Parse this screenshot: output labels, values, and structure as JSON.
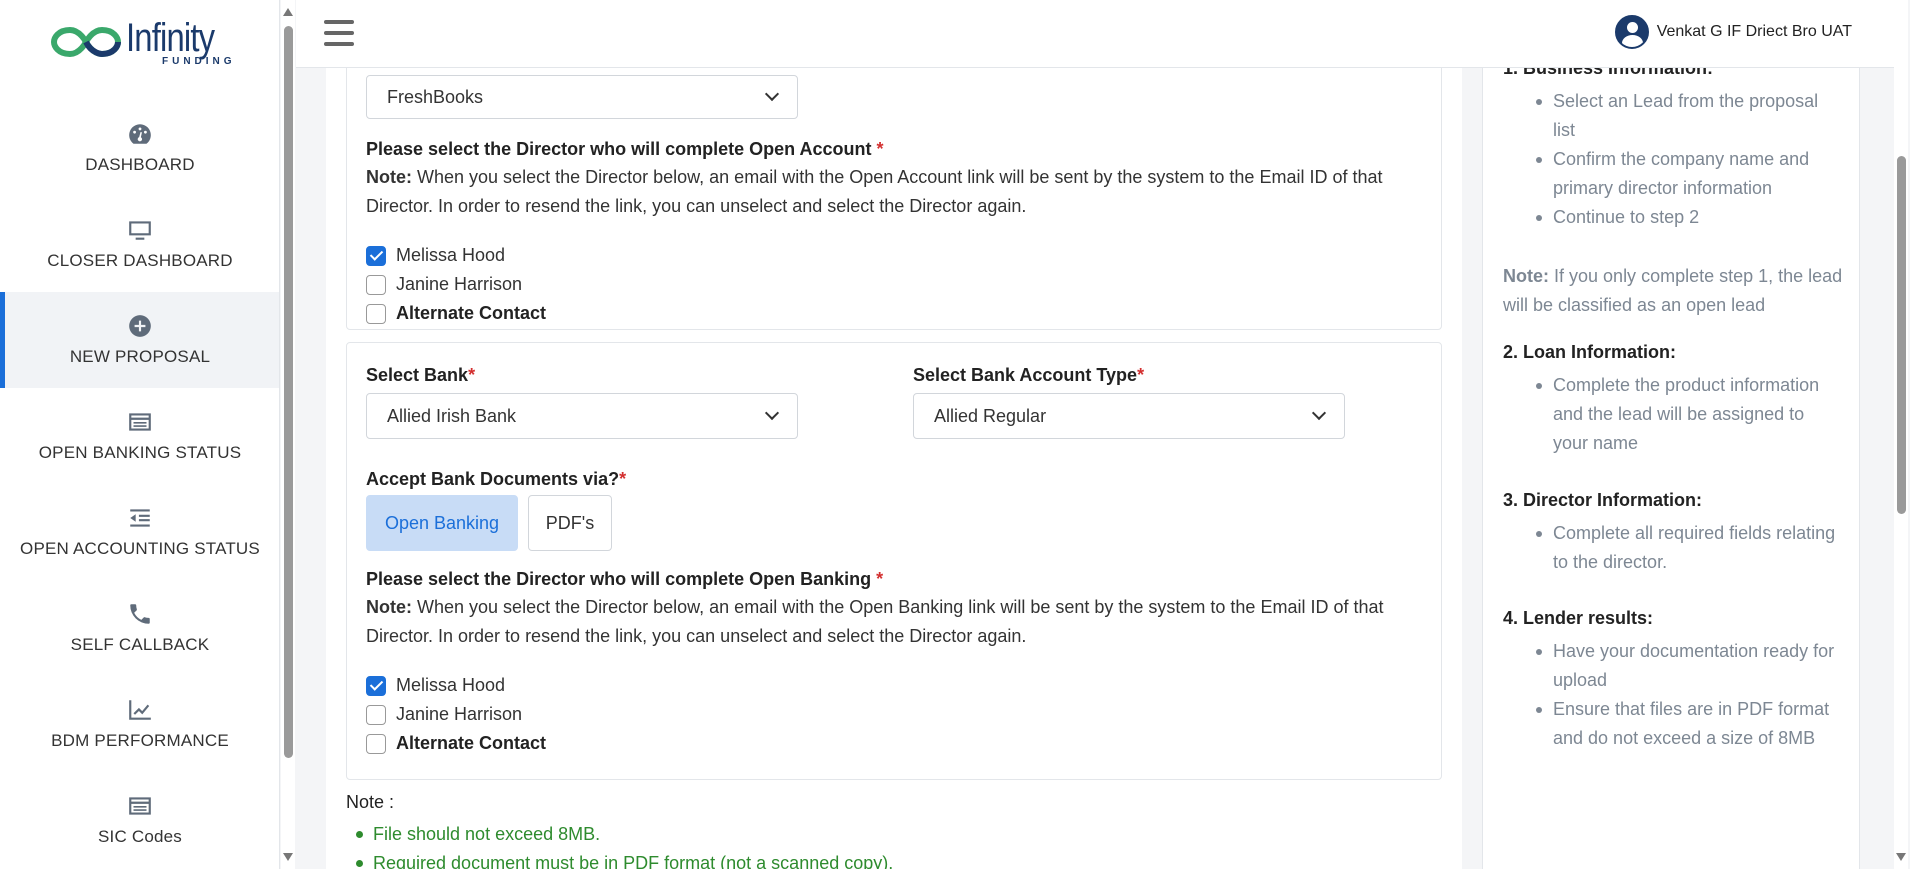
{
  "brand": {
    "name": "Infinity",
    "sub": "FUNDING"
  },
  "sidebar": {
    "items": [
      {
        "label": "DASHBOARD",
        "icon": "dashboard-icon"
      },
      {
        "label": "CLOSER DASHBOARD",
        "icon": "monitor-icon"
      },
      {
        "label": "NEW PROPOSAL",
        "icon": "plus-circle-icon",
        "active": true
      },
      {
        "label": "OPEN BANKING STATUS",
        "icon": "card-list-icon"
      },
      {
        "label": "OPEN ACCOUNTING STATUS",
        "icon": "indent-list-icon"
      },
      {
        "label": "SELF CALLBACK",
        "icon": "phone-icon"
      },
      {
        "label": "BDM PERFORMANCE",
        "icon": "chart-line-icon"
      },
      {
        "label": "SIC Codes",
        "icon": "card-list-icon"
      }
    ]
  },
  "header": {
    "user_name": "Venkat G IF Driect Bro UAT"
  },
  "accounting": {
    "software_value": "FreshBooks",
    "director_label": "Please select the Director who will complete Open Account",
    "note_label": "Note:",
    "note_text": "When you select the Director below, an email with the Open Account link will be sent by the system to the Email ID of that Director. In order to resend the link, you can unselect and select the Director again.",
    "directors": [
      {
        "name": "Melissa Hood",
        "checked": true
      },
      {
        "name": "Janine Harrison",
        "checked": false
      },
      {
        "name": "Alternate Contact",
        "checked": false
      }
    ]
  },
  "banking": {
    "bank_label": "Select Bank",
    "bank_value": "Allied Irish Bank",
    "account_type_label": "Select Bank Account Type",
    "account_type_value": "Allied Regular",
    "accept_label": "Accept Bank Documents via?",
    "accept_options": [
      "Open Banking",
      "PDF's"
    ],
    "director_label": "Please select the Director who will complete Open Banking",
    "note_label": "Note:",
    "note_text": "When you select the Director below, an email with the Open Banking link will be sent by the system to the Email ID of that Director. In order to resend the link, you can unselect and select the Director again.",
    "directors": [
      {
        "name": "Melissa Hood",
        "checked": true
      },
      {
        "name": "Janine Harrison",
        "checked": false
      },
      {
        "name": "Alternate Contact",
        "checked": false
      }
    ]
  },
  "file_notes": {
    "title": "Note :",
    "items": [
      "File should not exceed 8MB.",
      "Required document must be in PDF format (not a scanned copy)."
    ]
  },
  "help": {
    "s1_title": "1. Business Information:",
    "s1_items": [
      "Select an Lead from the proposal list",
      "Confirm the company name and primary director information",
      "Continue to step 2"
    ],
    "s1_note_label": "Note:",
    "s1_note": "If you only complete step 1, the lead will be classified as an open lead",
    "s2_title": "2. Loan Information:",
    "s2_items": [
      "Complete the product information and the lead will be assigned to your name"
    ],
    "s3_title": "3. Director Information:",
    "s3_items": [
      "Complete all required fields relating to the director."
    ],
    "s4_title": "4. Lender results:",
    "s4_items": [
      "Have your documentation ready for upload",
      "Ensure that files are in PDF format and do not exceed a size of 8MB"
    ]
  },
  "required_mark": "*"
}
